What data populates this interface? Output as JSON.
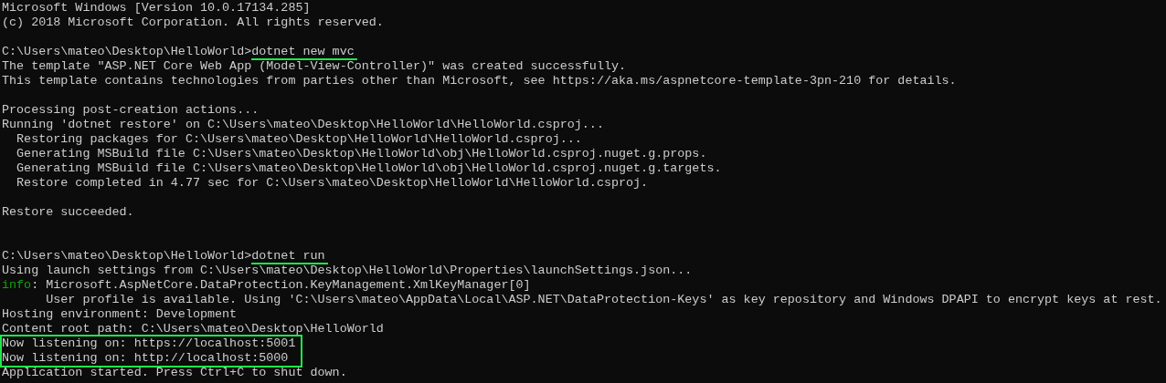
{
  "console": {
    "lines": [
      {
        "kind": "text",
        "text": "Microsoft Windows [Version 10.0.17134.285]"
      },
      {
        "kind": "text",
        "text": "(c) 2018 Microsoft Corporation. All rights reserved."
      },
      {
        "kind": "blank"
      },
      {
        "kind": "prompt",
        "prompt": "C:\\Users\\mateo\\Desktop\\HelloWorld>",
        "command": "dotnet new mvc",
        "underlined": true
      },
      {
        "kind": "text",
        "text": "The template \"ASP.NET Core Web App (Model-View-Controller)\" was created successfully."
      },
      {
        "kind": "text",
        "text": "This template contains technologies from parties other than Microsoft, see https://aka.ms/aspnetcore-template-3pn-210 for details."
      },
      {
        "kind": "blank"
      },
      {
        "kind": "text",
        "text": "Processing post-creation actions..."
      },
      {
        "kind": "text",
        "text": "Running 'dotnet restore' on C:\\Users\\mateo\\Desktop\\HelloWorld\\HelloWorld.csproj..."
      },
      {
        "kind": "text",
        "text": "  Restoring packages for C:\\Users\\mateo\\Desktop\\HelloWorld\\HelloWorld.csproj..."
      },
      {
        "kind": "text",
        "text": "  Generating MSBuild file C:\\Users\\mateo\\Desktop\\HelloWorld\\obj\\HelloWorld.csproj.nuget.g.props."
      },
      {
        "kind": "text",
        "text": "  Generating MSBuild file C:\\Users\\mateo\\Desktop\\HelloWorld\\obj\\HelloWorld.csproj.nuget.g.targets."
      },
      {
        "kind": "text",
        "text": "  Restore completed in 4.77 sec for C:\\Users\\mateo\\Desktop\\HelloWorld\\HelloWorld.csproj."
      },
      {
        "kind": "blank"
      },
      {
        "kind": "text",
        "text": "Restore succeeded."
      },
      {
        "kind": "blank"
      },
      {
        "kind": "blank"
      },
      {
        "kind": "prompt",
        "prompt": "C:\\Users\\mateo\\Desktop\\HelloWorld>",
        "command": "dotnet run",
        "underlined": true
      },
      {
        "kind": "text",
        "text": "Using launch settings from C:\\Users\\mateo\\Desktop\\HelloWorld\\Properties\\launchSettings.json..."
      },
      {
        "kind": "log",
        "level": "info",
        "message": ": Microsoft.AspNetCore.DataProtection.KeyManagement.XmlKeyManager[0]"
      },
      {
        "kind": "text",
        "text": "      User profile is available. Using 'C:\\Users\\mateo\\AppData\\Local\\ASP.NET\\DataProtection-Keys' as key repository and Windows DPAPI to encrypt keys at rest."
      },
      {
        "kind": "text",
        "text": "Hosting environment: Development"
      },
      {
        "kind": "text",
        "text": "Content root path: C:\\Users\\mateo\\Desktop\\HelloWorld"
      },
      {
        "kind": "text",
        "text": "Now listening on: https://localhost:5001",
        "highlighted": true
      },
      {
        "kind": "text",
        "text": "Now listening on: http://localhost:5000",
        "highlighted": true
      },
      {
        "kind": "text",
        "text": "Application started. Press Ctrl+C to shut down."
      }
    ]
  }
}
